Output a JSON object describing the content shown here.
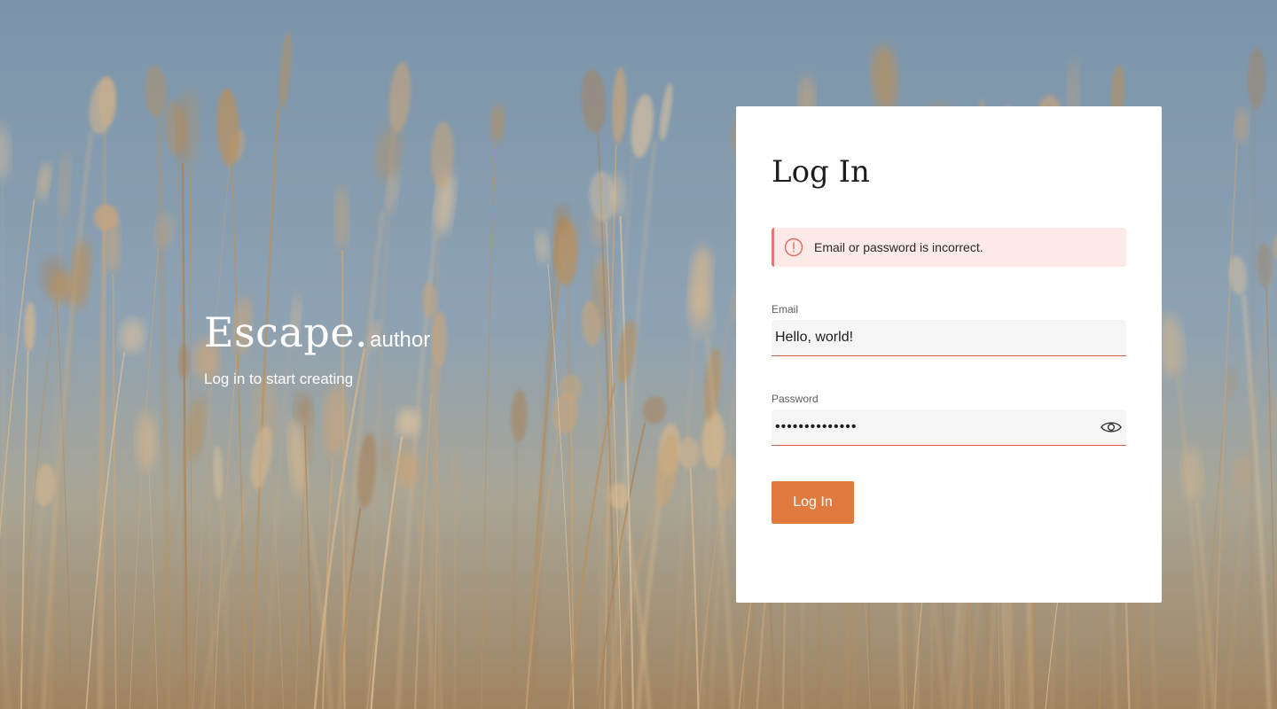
{
  "brand": {
    "name": "Escape.",
    "suffix": "author",
    "tagline": "Log in to start creating"
  },
  "login_card": {
    "title": "Log In",
    "error_message": "Email or password is incorrect.",
    "email": {
      "label": "Email",
      "value": "Hello, world!"
    },
    "password": {
      "label": "Password",
      "value": "••••••••••••••"
    },
    "submit_label": "Log In"
  },
  "icons": {
    "alert": "alert-circle-icon",
    "show_password": "eye-icon"
  },
  "colors": {
    "accent": "#e07a3f",
    "error": "#d95f4d",
    "error_bg": "#fde9e7",
    "card_bg": "#ffffff",
    "field_bg": "#f5f5f5"
  }
}
